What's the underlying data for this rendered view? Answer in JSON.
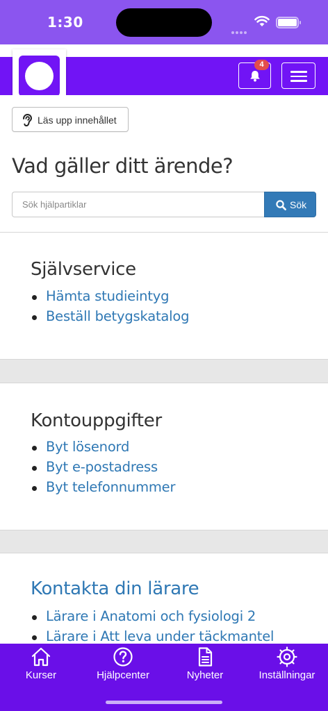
{
  "status_bar": {
    "time": "1:30"
  },
  "header": {
    "notification_count": "4"
  },
  "accessibility": {
    "read_aloud_label": "Läs upp innehållet"
  },
  "page": {
    "title": "Vad gäller ditt ärende?"
  },
  "search": {
    "placeholder": "Sök hjälpartiklar",
    "button_label": "Sök"
  },
  "sections": [
    {
      "title": "Självservice",
      "links": [
        "Hämta studieintyg",
        "Beställ betygskatalog"
      ]
    },
    {
      "title": "Kontouppgifter",
      "links": [
        "Byt lösenord",
        "Byt e-postadress",
        "Byt telefonnummer"
      ]
    },
    {
      "title": "Kontakta din lärare",
      "links": [
        "Lärare i Anatomi och fysiologi 2",
        "Lärare i Att leva under täckmantel"
      ]
    }
  ],
  "tabs": [
    {
      "label": "Kurser",
      "icon": "home-icon"
    },
    {
      "label": "Hjälpcenter",
      "icon": "help-circle-icon"
    },
    {
      "label": "Nyheter",
      "icon": "document-icon"
    },
    {
      "label": "Inställningar",
      "icon": "gear-icon"
    }
  ],
  "colors": {
    "primary": "#7114f5",
    "status_bar": "#8b55ef",
    "link": "#2f78b4",
    "search_button": "#337ab7",
    "badge": "#e34d4d"
  }
}
